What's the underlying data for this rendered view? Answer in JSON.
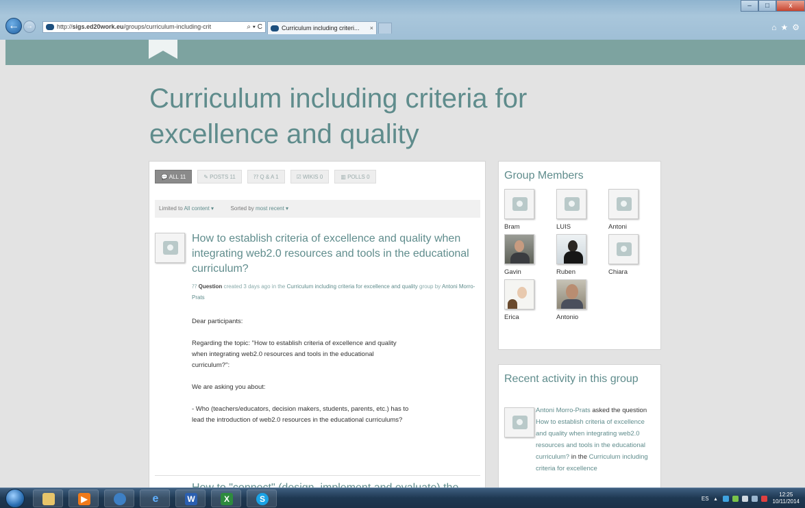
{
  "browser": {
    "url_scheme": "http://",
    "url_domain": "sigs.ed20work.eu",
    "url_path": "/groups/curriculum-including-crit",
    "url_tools": "⌕ ▾ C",
    "tab_title": "Curriculum including criteri...",
    "tab_close": "×",
    "minimize": "–",
    "maximize": "□",
    "close": "x"
  },
  "page": {
    "title": "Curriculum including criteria for excellence and quality"
  },
  "filters": [
    {
      "label": "ALL 11",
      "active": true
    },
    {
      "label": "POSTS 11",
      "active": false
    },
    {
      "label": "Q & A 1",
      "active": false
    },
    {
      "label": "WIKIS 0",
      "active": false
    },
    {
      "label": "POLLS 0",
      "active": false
    }
  ],
  "sortbar": {
    "limited_prefix": "Limited to",
    "limited_value": "All content ▾",
    "sorted_prefix": "Sorted by",
    "sorted_value": "most recent ▾"
  },
  "post": {
    "title": "How to establish criteria of excellence and quality when integrating web2.0 resources and tools in the educational curriculum?",
    "type": "Question",
    "created": "created 3 days ago in the",
    "group_link": "Curriculum including criteria for excellence and quality",
    "by": "group by",
    "author": "Antoni Morro-Prats",
    "body": [
      "Dear participants:",
      "Regarding the topic: \"How to establish criteria of excellence and quality when integrating web2.0 resources and tools in the educational curriculum?\":",
      "We are asking you about:",
      "- Who (teachers/educators, decision makers, students, parents, etc.) has to lead the introduction of web2.0 resources in the educational curriculums?"
    ],
    "next_title": "How to \"connect\" (design, implement and evaluate) the"
  },
  "members": {
    "heading": "Group Members",
    "list": [
      {
        "name": "Bram",
        "photo": false
      },
      {
        "name": "LUIS",
        "photo": false
      },
      {
        "name": "Antoni",
        "photo": false
      },
      {
        "name": "Gavin",
        "photo": true
      },
      {
        "name": "Ruben",
        "photo": true
      },
      {
        "name": "Chiara",
        "photo": false
      },
      {
        "name": "Erica",
        "photo": true
      },
      {
        "name": "Antonio",
        "photo": true
      }
    ]
  },
  "activity": {
    "heading": "Recent activity in this group",
    "actor": "Antoni Morro-Prats",
    "verb": "asked the question",
    "question": "How to establish criteria of excellence and quality when integrating web2.0 resources and tools in the educational curriculum?",
    "in_the": "in the",
    "group": "Curriculum including criteria for excellence"
  },
  "taskbar": {
    "lang": "ES",
    "time": "12:25",
    "date": "10/11/2014",
    "icons": [
      "explorer-icon",
      "media-player-icon",
      "network-icon",
      "internet-explorer-icon",
      "word-icon",
      "excel-icon",
      "skype-icon"
    ]
  },
  "colors": {
    "accent": "#5f8c8c",
    "band": "#7da3a0"
  }
}
